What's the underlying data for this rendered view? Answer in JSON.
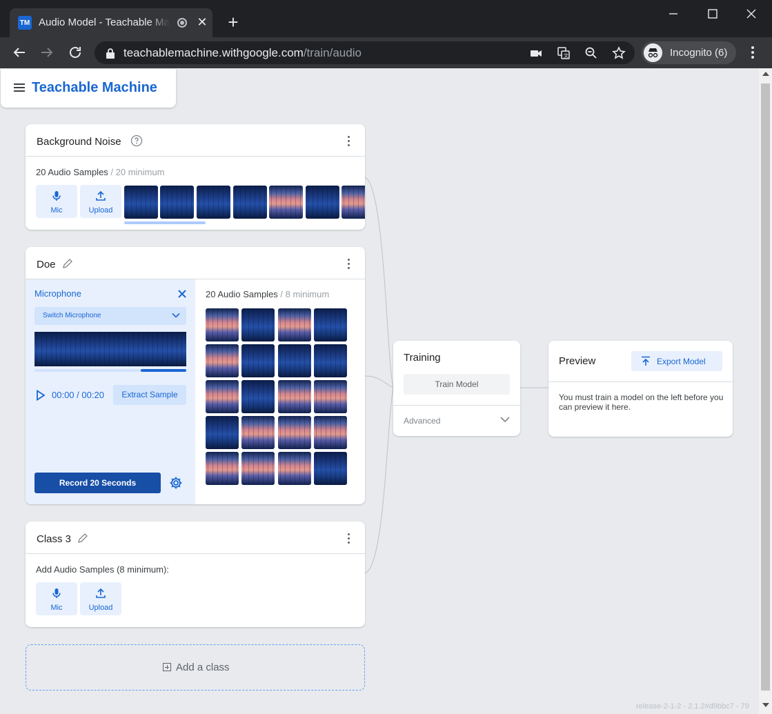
{
  "browser": {
    "tab_title": "Audio Model - Teachable Machine",
    "favicon_text": "TM",
    "url_host": "teachablemachine.withgoogle.com",
    "url_path": "/train/audio",
    "incognito_label": "Incognito (6)"
  },
  "app": {
    "name": "Teachable Machine"
  },
  "classes": [
    {
      "name": "Background Noise",
      "sample_count": "20 Audio Samples",
      "sample_min": " / 20 minimum",
      "mic_label": "Mic",
      "upload_label": "Upload"
    },
    {
      "name": "Doe",
      "microphone_title": "Microphone",
      "switch_microphone": "Switch Microphone",
      "time_current": "00:00",
      "time_sep": " / ",
      "time_total": "00:20",
      "extract_label": "Extract Sample",
      "record_label": "Record 20 Seconds",
      "sample_count": "20 Audio Samples",
      "sample_min": " / 8 minimum",
      "recording_progress": 0.3
    },
    {
      "name": "Class 3",
      "add_samples": "Add Audio Samples (8 minimum):",
      "mic_label": "Mic",
      "upload_label": "Upload"
    }
  ],
  "add_class_label": "Add a class",
  "training": {
    "title": "Training",
    "train_button": "Train Model",
    "advanced_label": "Advanced"
  },
  "preview": {
    "title": "Preview",
    "export_button": "Export Model",
    "message": "You must train a model on the left before you can preview it here."
  },
  "release": "release-2-1-2 - 2.1.2#d9bbc7 - 79",
  "colors": {
    "accent": "#1967d2",
    "record_button": "#174ea6",
    "panel_bg": "#e8f0fe",
    "page_bg": "#e8eaed"
  },
  "icons": [
    "hamburger-icon",
    "help-icon",
    "pencil-icon",
    "kebab-menu-icon",
    "mic-icon",
    "upload-icon",
    "close-icon",
    "chevron-down-icon",
    "play-icon",
    "gear-icon",
    "export-icon",
    "plus-box-icon"
  ]
}
